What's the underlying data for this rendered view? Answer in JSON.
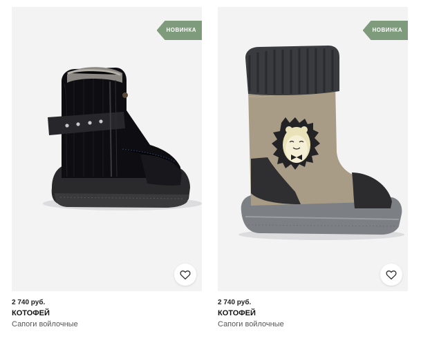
{
  "products": [
    {
      "badge": "НОВИНКА",
      "price": "2 740 руб.",
      "brand": "КОТОФЕЙ",
      "description": "Сапоги войлочные",
      "image_icon": "black-felt-boot-image",
      "favorite_icon": "heart-outline-icon"
    },
    {
      "badge": "НОВИНКА",
      "price": "2 740 руб.",
      "brand": "КОТОФЕЙ",
      "description": "Сапоги войлочные",
      "image_icon": "beige-felt-boot-hedgehog-image",
      "favorite_icon": "heart-outline-icon"
    }
  ],
  "colors": {
    "badge_bg": "#7e9b7c",
    "photo_bg": "#f3f3f4",
    "text": "#222222"
  }
}
